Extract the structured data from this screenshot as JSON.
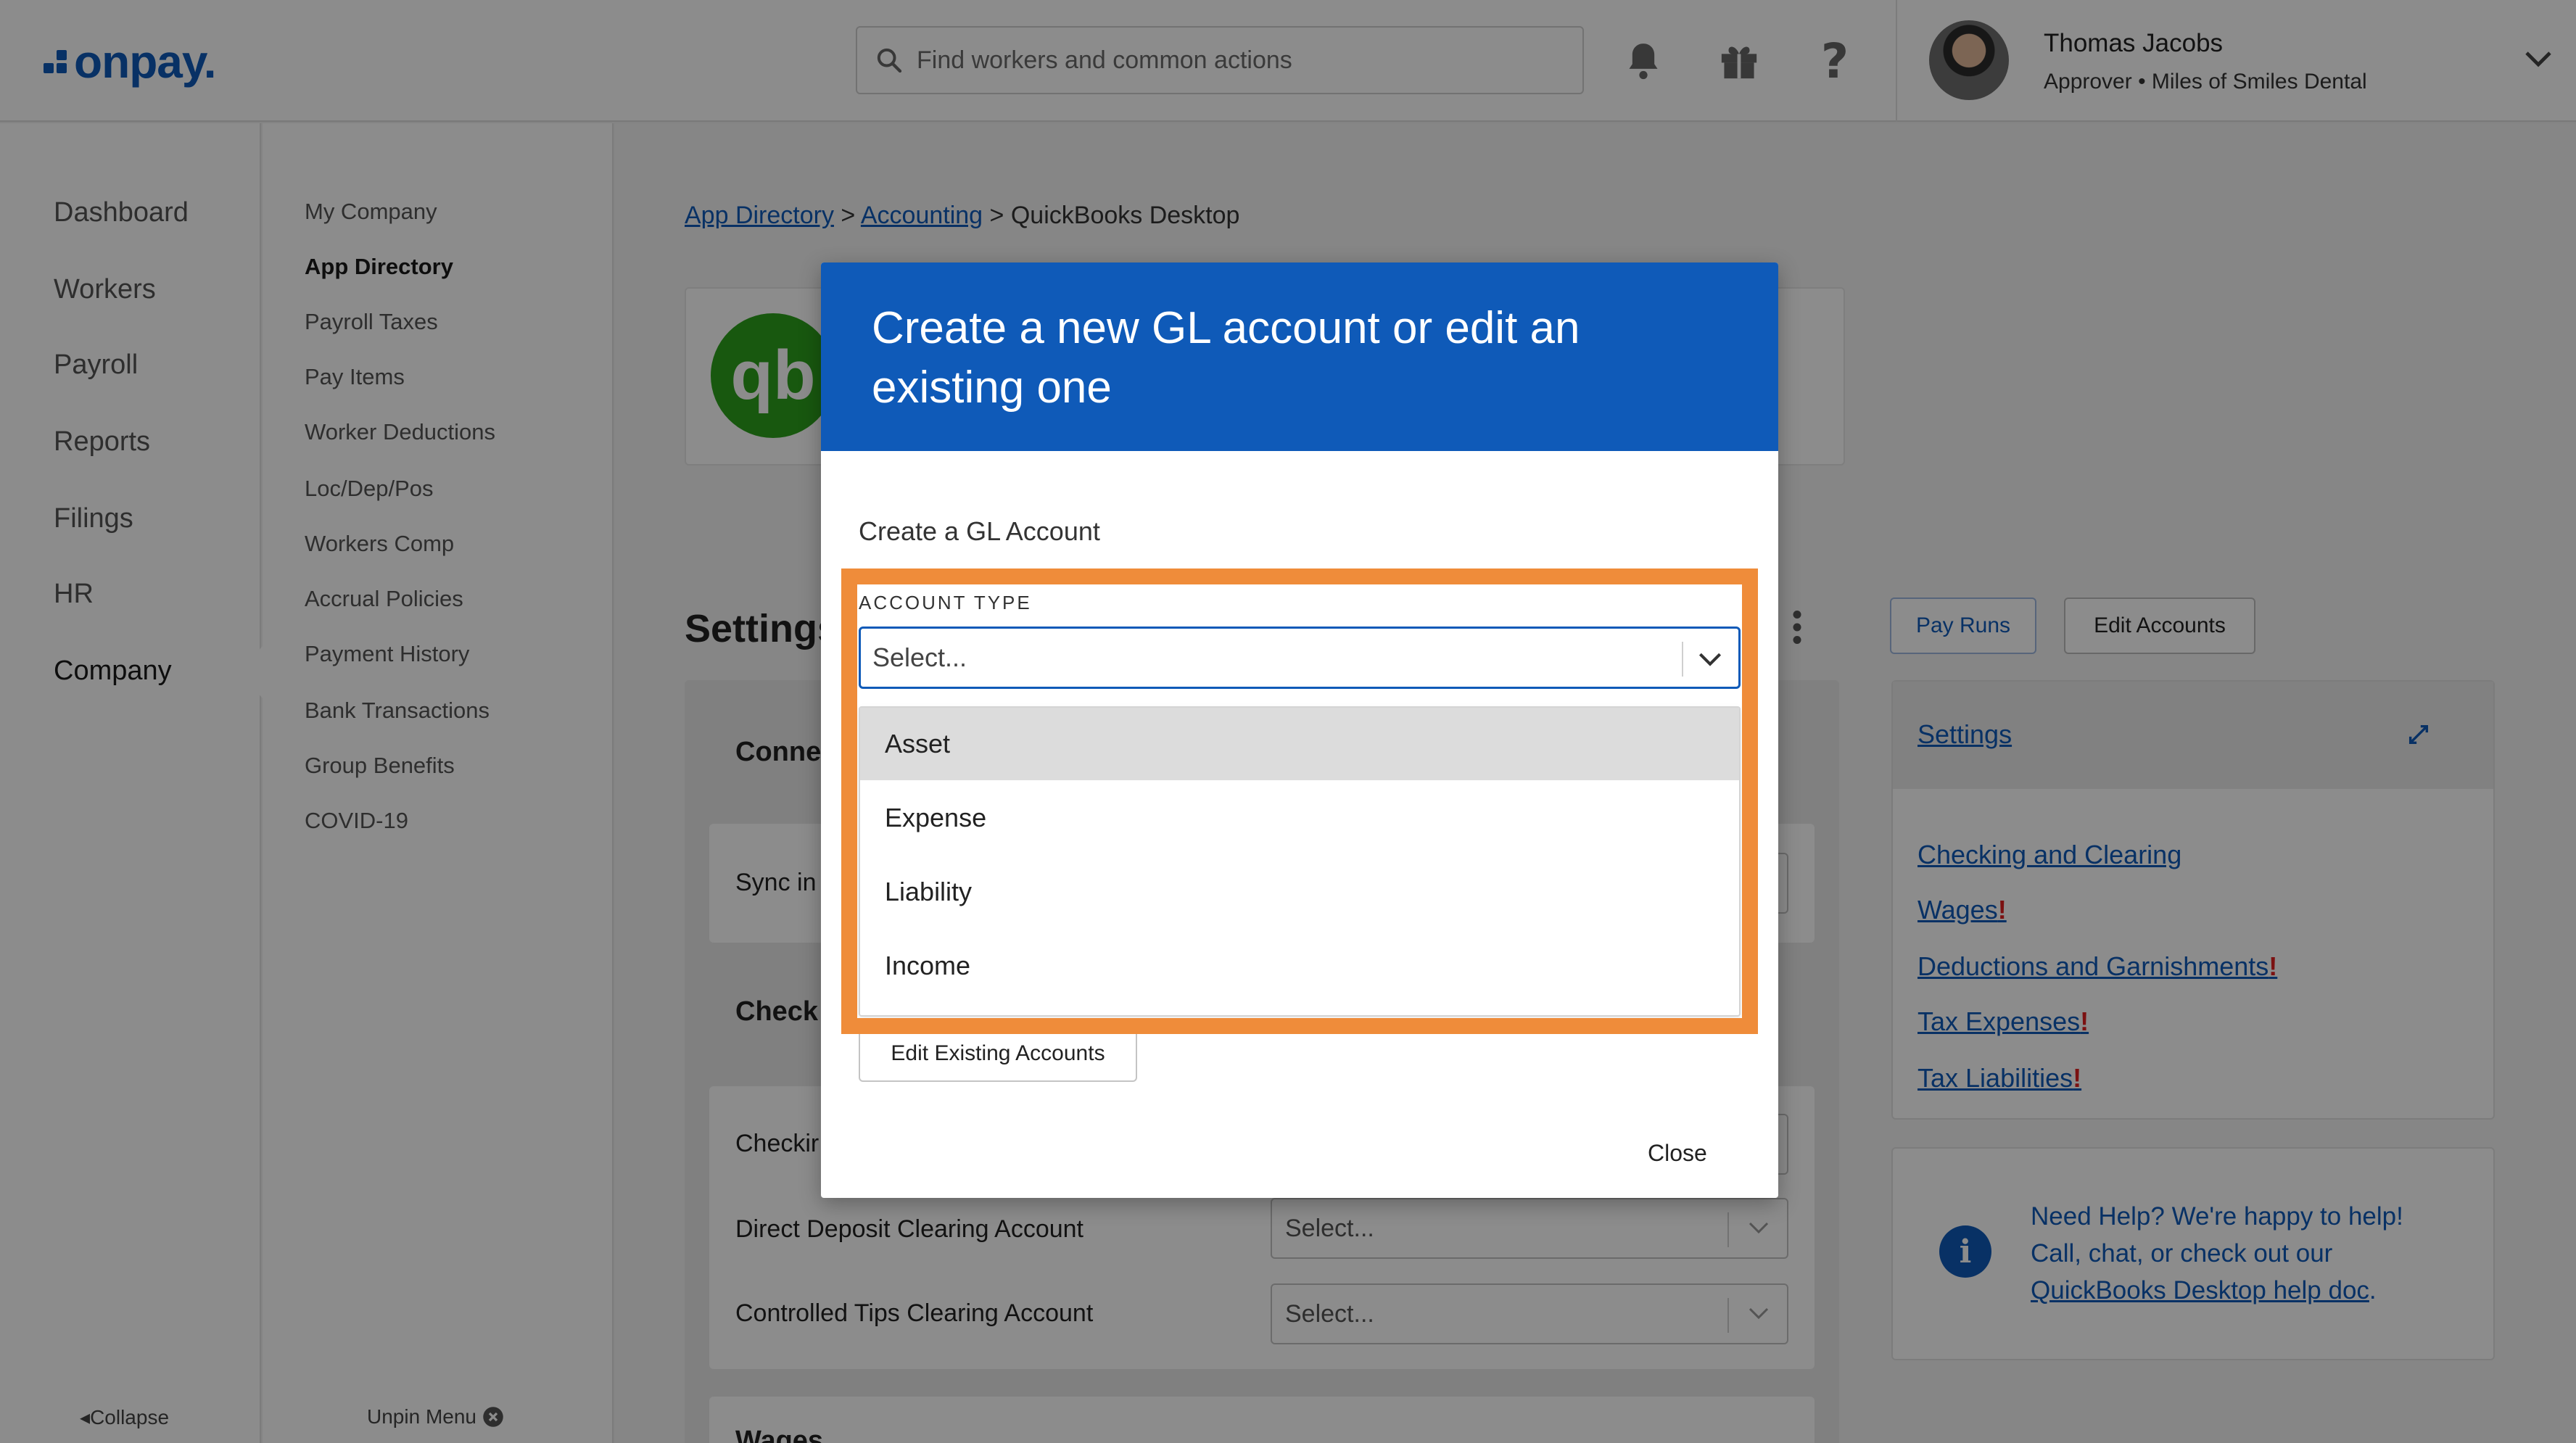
{
  "header": {
    "logo": "onpay.",
    "search_placeholder": "Find workers and common actions",
    "user_name": "Thomas Jacobs",
    "user_role": "Approver • Miles of Smiles Dental"
  },
  "nav_primary": [
    "Dashboard",
    "Workers",
    "Payroll",
    "Reports",
    "Filings",
    "HR",
    "Company"
  ],
  "nav_secondary": [
    "My Company",
    "App Directory",
    "Payroll Taxes",
    "Pay Items",
    "Worker Deductions",
    "Loc/Dep/Pos",
    "Workers Comp",
    "Accrual Policies",
    "Payment History",
    "Bank Transactions",
    "Group Benefits",
    "COVID-19"
  ],
  "sidebar_footer": {
    "collapse": "Collapse",
    "unpin": "Unpin Menu"
  },
  "breadcrumb": {
    "app_directory": "App Directory",
    "sep": ">",
    "accounting": "Accounting",
    "current": "QuickBooks Desktop"
  },
  "page": {
    "settings_title": "Settings",
    "pay_runs": "Pay Runs",
    "edit_accounts": "Edit Accounts",
    "conn_label": "Conne",
    "sync_label": "Sync in",
    "check_label": "Check",
    "checking_label": "Checkir",
    "direct_deposit_label": "Direct Deposit Clearing Account",
    "controlled_tips_label": "Controlled Tips Clearing Account",
    "select_placeholder": "Select...",
    "wages_label": "Wages"
  },
  "right_panel": {
    "settings": "Settings",
    "links": [
      {
        "label": "Checking and Clearing",
        "warn": ""
      },
      {
        "label": "Wages",
        "warn": "!"
      },
      {
        "label": "Deductions and Garnishments",
        "warn": "!"
      },
      {
        "label": "Tax Expenses",
        "warn": "!"
      },
      {
        "label": "Tax Liabilities",
        "warn": "!"
      }
    ],
    "help_line1": "Need Help? We're happy to help!",
    "help_line2": "Call, chat, or check out our",
    "help_link": "QuickBooks Desktop help doc",
    "help_period": "."
  },
  "modal": {
    "title": "Create a new GL account or edit an existing one",
    "subtitle": "Create a GL Account",
    "account_type_label": "ACCOUNT TYPE",
    "select_placeholder": "Select...",
    "options": [
      "Asset",
      "Expense",
      "Liability",
      "Income"
    ],
    "edit_existing": "Edit Existing Accounts",
    "close": "Close"
  },
  "colors": {
    "brand": "#0f5ab8",
    "highlight": "#ef8c3a",
    "warn": "#e02020",
    "quickbooks": "#2ca01c"
  }
}
